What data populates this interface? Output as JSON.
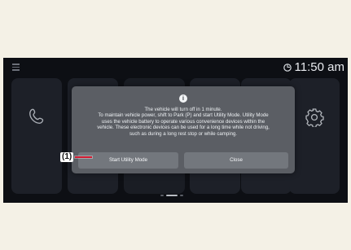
{
  "status_bar": {
    "time": "11:50",
    "time_suffix": "am"
  },
  "dialog": {
    "lines": [
      "The vehicle will turn off in 1 minute.",
      "To maintain vehicle power, shift to Park (P) and start Utility Mode. Utility Mode",
      "uses the vehicle battery to operate various convenience devices within the",
      "vehicle. These electronic devices can be used for a long time while not driving,",
      "such as during a long rest stop or while camping."
    ],
    "start_label": "Start Utility Mode",
    "close_label": "Close"
  },
  "callout": {
    "number": "(1)"
  },
  "icons": {
    "info": "info-icon",
    "phone": "phone-icon",
    "settings": "gear-icon",
    "menu": "menu-icon",
    "sync": "sync-icon"
  },
  "colors": {
    "page_background": "#f4f1e6",
    "screen_background": "#0d0f14",
    "dialog_background": "#5b5e64",
    "callout_line": "#d21b32"
  }
}
